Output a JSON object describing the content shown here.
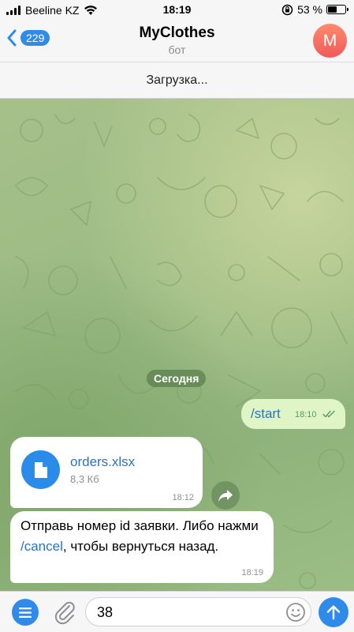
{
  "status_bar": {
    "carrier": "Beeline KZ",
    "time": "18:19",
    "battery_percent": "53 %",
    "battery_level": 0.53
  },
  "header": {
    "back_count": "229",
    "title": "MyClothes",
    "subtitle": "бот",
    "avatar_letter": "M"
  },
  "banner": {
    "loading_text": "Загрузка..."
  },
  "chat": {
    "date_chip": "Сегодня",
    "messages": [
      {
        "direction": "outgoing",
        "text": "/start",
        "time": "18:10"
      },
      {
        "direction": "incoming",
        "file_name": "orders.xlsx",
        "file_size": "8,3 Кб",
        "time": "18:12"
      },
      {
        "direction": "incoming",
        "text_before": "Отправь номер id заявки. Либо нажми ",
        "link": "/cancel",
        "text_after": ", чтобы вернуться назад.",
        "time": "18:19"
      }
    ]
  },
  "input": {
    "value": "38"
  },
  "colors": {
    "accent": "#2f8bea",
    "outgoing_bubble": "#dff5c6",
    "link": "#2a73c4"
  },
  "icons": {
    "signal": "signal-icon",
    "wifi": "wifi-icon",
    "rotation_lock": "rotation-lock-icon",
    "battery": "battery-icon",
    "back": "chevron-left-icon",
    "file": "document-icon",
    "share": "share-icon",
    "menu": "menu-icon",
    "attach": "paperclip-icon",
    "emoji": "smiley-icon",
    "send": "arrow-up-icon"
  }
}
